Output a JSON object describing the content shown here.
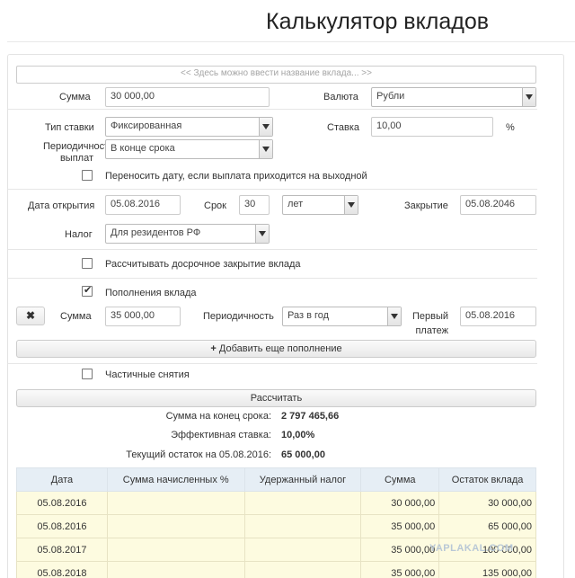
{
  "page": {
    "title": "Калькулятор вкладов"
  },
  "form": {
    "name_placeholder": "<< Здесь можно ввести название вклада... >>",
    "sum_label": "Сумма",
    "sum_value": "30 000,00",
    "currency_label": "Валюта",
    "currency_value": "Рубли",
    "rate_type_label": "Тип ставки",
    "rate_type_value": "Фиксированная",
    "rate_label": "Ставка",
    "rate_value": "10,00",
    "rate_unit": "%",
    "period_label_1": "Периодичность",
    "period_label_2": "выплат",
    "period_value": "В конце срока",
    "move_date_label": "Переносить дату, если выплата приходится на выходной",
    "move_date_checked": false,
    "open_date_label": "Дата открытия",
    "open_date_value": "05.08.2016",
    "term_label": "Срок",
    "term_value": "30",
    "term_unit_value": "лет",
    "close_label": "Закрытие",
    "close_value": "05.08.2046",
    "tax_label": "Налог",
    "tax_value": "Для резидентов РФ",
    "early_close_label": "Рассчитывать досрочное закрытие вклада",
    "early_close_checked": false,
    "topup_label": "Пополнения вклада",
    "topup_checked": true,
    "topup_remove_icon": "close-icon",
    "topup_sum_label": "Сумма",
    "topup_sum_value": "35 000,00",
    "topup_period_label": "Периодичность",
    "topup_period_value": "Раз в год",
    "first_payment_label_1": "Первый",
    "first_payment_label_2": "платеж",
    "first_payment_value": "05.08.2016",
    "add_topup_label": "Добавить еще пополнение",
    "partial_withdraw_label": "Частичные снятия",
    "partial_withdraw_checked": false,
    "calculate_label": "Рассчитать"
  },
  "summary": {
    "end_sum_label": "Сумма на конец срока:",
    "end_sum_value": "2 797 465,66",
    "effective_rate_label": "Эффективная ставка:",
    "effective_rate_value": "10,00%",
    "balance_label": "Текущий остаток на 05.08.2016:",
    "balance_value": "65 000,00"
  },
  "table": {
    "headers": [
      "Дата",
      "Сумма начисленных %",
      "Удержанный налог",
      "Сумма",
      "Остаток вклада"
    ],
    "rows": [
      [
        "05.08.2016",
        "",
        "",
        "30 000,00",
        "30 000,00"
      ],
      [
        "05.08.2016",
        "",
        "",
        "35 000,00",
        "65 000,00"
      ],
      [
        "05.08.2017",
        "",
        "",
        "35 000,00",
        "100 000,00"
      ],
      [
        "05.08.2018",
        "",
        "",
        "35 000,00",
        "135 000,00"
      ]
    ]
  },
  "watermark": "YAPLAKAL.COM"
}
